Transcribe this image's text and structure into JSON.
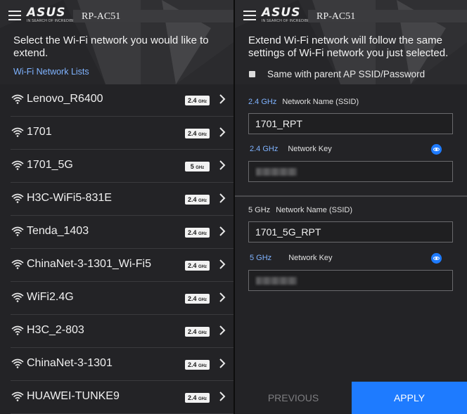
{
  "app": {
    "brand": "ASUS",
    "tagline": "IN SEARCH OF INCREDIBLE",
    "device_title": "RP-AC51"
  },
  "left": {
    "instruction": "Select the Wi-Fi network you would like to extend.",
    "section_link": "Wi-Fi Network Lists",
    "networks": [
      {
        "name": "Lenovo_R6400",
        "band": "2.4",
        "unit": "GHz"
      },
      {
        "name": "1701",
        "band": "2.4",
        "unit": "GHz"
      },
      {
        "name": "1701_5G",
        "band": "5",
        "unit": "GHz"
      },
      {
        "name": "H3C-WiFi5-831E",
        "band": "2.4",
        "unit": "GHz"
      },
      {
        "name": "Tenda_1403",
        "band": "2.4",
        "unit": "GHz"
      },
      {
        "name": "ChinaNet-3-1301_Wi-Fi5",
        "band": "2.4",
        "unit": "GHz"
      },
      {
        "name": "WiFi2.4G",
        "band": "2.4",
        "unit": "GHz"
      },
      {
        "name": "H3C_2-803",
        "band": "2.4",
        "unit": "GHz"
      },
      {
        "name": "ChinaNet-3-1301",
        "band": "2.4",
        "unit": "GHz"
      },
      {
        "name": "HUAWEI-TUNKE9",
        "band": "2.4",
        "unit": "GHz"
      }
    ]
  },
  "right": {
    "description": "Extend Wi-Fi network will follow the same settings of Wi-Fi network you just selected.",
    "same_parent_label": "Same with parent AP SSID/Password",
    "band24": {
      "ghz": "2.4 GHz",
      "ssid_label": "Network Name (SSID)",
      "ssid_value": "1701_RPT",
      "key_label": "Network Key"
    },
    "band5": {
      "ghz": "5 GHz",
      "ssid_label": "Network Name (SSID)",
      "ssid_value": "1701_5G_RPT",
      "key_label": "Network Key"
    },
    "previous_label": "PREVIOUS",
    "apply_label": "APPLY"
  },
  "colors": {
    "accent": "#1e7bff",
    "link": "#7fb3ff",
    "background": "#232326"
  }
}
